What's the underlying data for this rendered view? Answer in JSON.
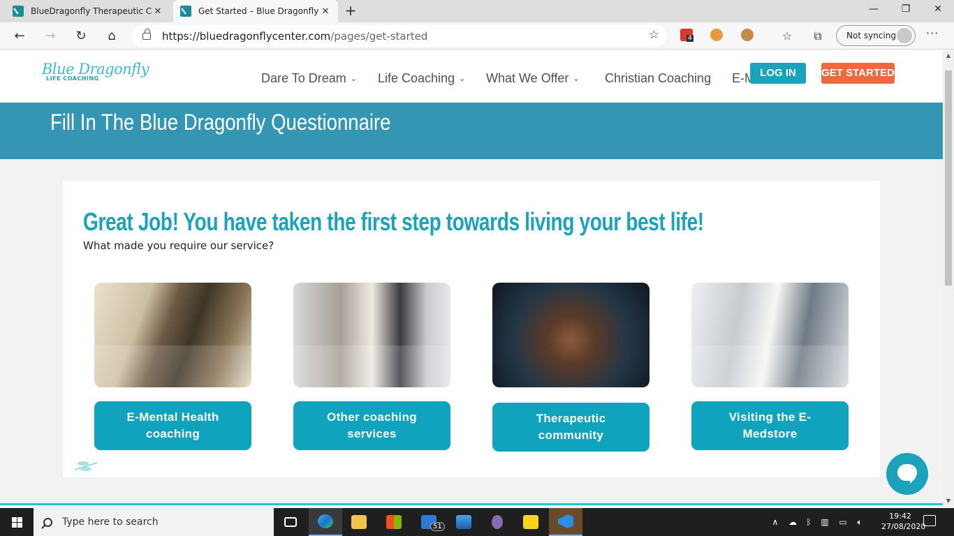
{
  "browser": {
    "tabs": [
      {
        "title": "BlueDragonfly Therapeutic Comm",
        "active": false
      },
      {
        "title": "Get Started – Blue Dragonfly Cen",
        "active": true
      }
    ],
    "new_tab_icon": "+",
    "window_controls": {
      "minimize": "—",
      "maximize": "❐",
      "close": "✕"
    },
    "url_host": "https://bluedragonflycenter.com",
    "url_path": "/pages/get-started",
    "extension_badge": "4",
    "profile_label": "Not syncing",
    "more_icon": "···"
  },
  "site": {
    "logo_script": "Blue Dragonfly",
    "logo_sub": "LIFE COACHING",
    "nav": [
      {
        "label": "Dare To Dream",
        "has_dropdown": true
      },
      {
        "label": "Life Coaching",
        "has_dropdown": true
      },
      {
        "label": "What We Offer",
        "has_dropdown": true
      },
      {
        "label": "Christian Coaching",
        "has_dropdown": false
      },
      {
        "label": "E-Medstore",
        "has_dropdown": false
      }
    ],
    "login_label": "LOG IN",
    "get_started_label": "GET STARTED",
    "banner_title": "Fill In The Blue Dragonfly Questionnaire",
    "headline": "Great Job! You have taken the first step towards living your best life!",
    "question": "What made you require our service?",
    "options": [
      {
        "label": "E-Mental Health coaching",
        "photo": "two men talking at a table"
      },
      {
        "label": "Other coaching services",
        "photo": "two women talking at a table"
      },
      {
        "label": "Therapeutic community",
        "photo": "circle of joined hands"
      },
      {
        "label": "Visiting the E-Medstore",
        "photo": "pharmacy counter"
      }
    ],
    "colors": {
      "brand_teal": "#1aa3bb",
      "banner_blue": "#3596b3",
      "cta_orange": "#ee6a3e",
      "nav_text": "#47535b"
    }
  },
  "taskbar": {
    "search_placeholder": "Type here to search",
    "mail_badge": "51",
    "time": "19:42",
    "date": "27/08/2020"
  }
}
